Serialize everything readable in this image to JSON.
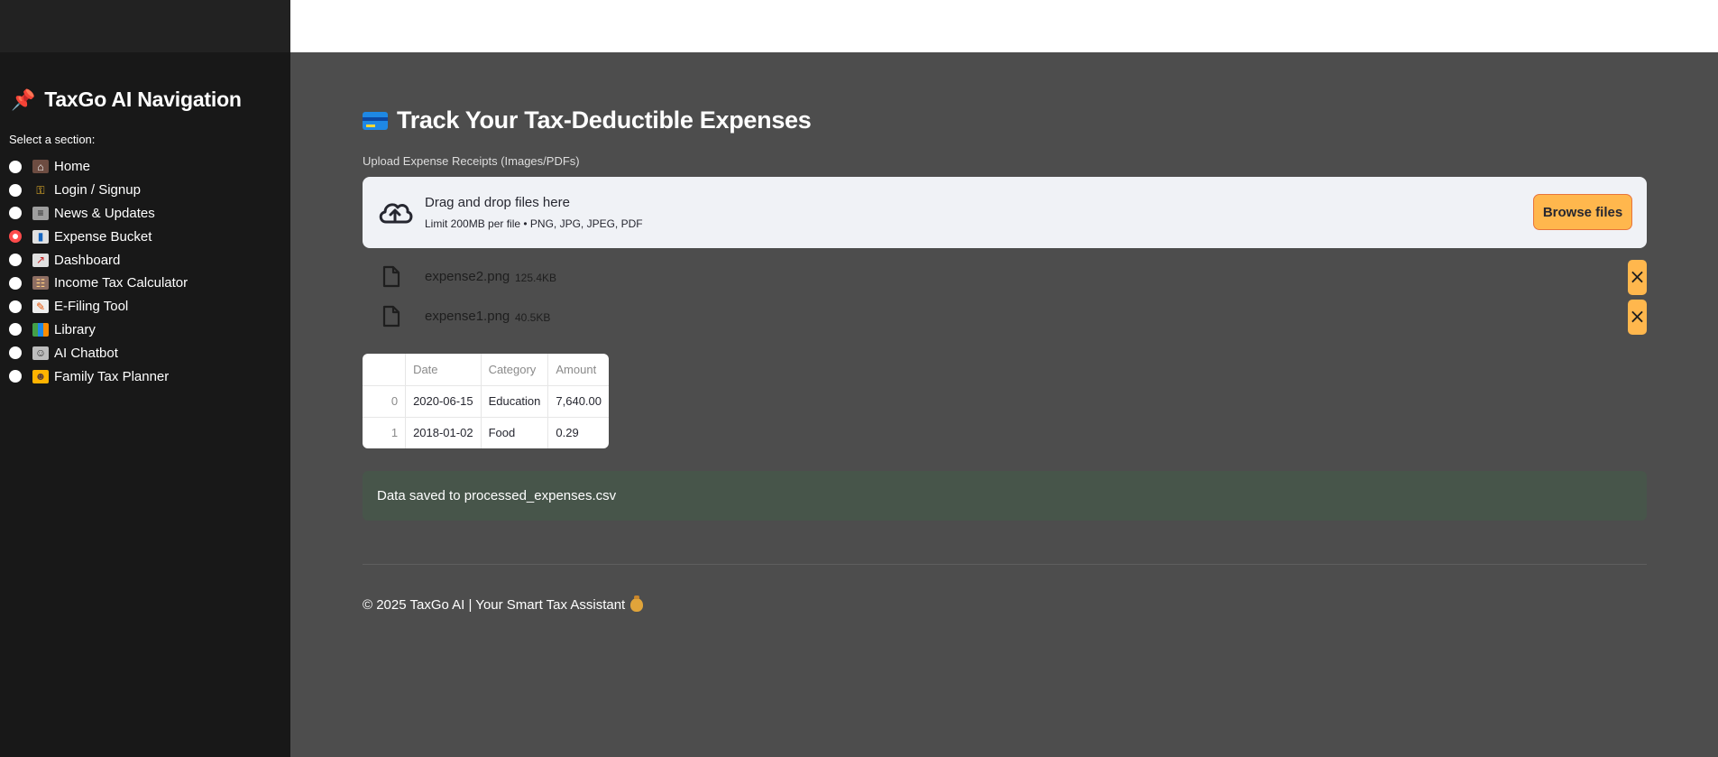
{
  "sidebar": {
    "title": "TaxGo AI Navigation",
    "section_label": "Select a section:",
    "items": [
      {
        "label": "Home",
        "icon": "house-icon",
        "selected": false
      },
      {
        "label": "Login / Signup",
        "icon": "key-icon",
        "selected": false
      },
      {
        "label": "News & Updates",
        "icon": "newspaper-icon",
        "selected": false
      },
      {
        "label": "Expense Bucket",
        "icon": "bar-chart-icon",
        "selected": true
      },
      {
        "label": "Dashboard",
        "icon": "chart-up-icon",
        "selected": false
      },
      {
        "label": "Income Tax Calculator",
        "icon": "abacus-icon",
        "selected": false
      },
      {
        "label": "E-Filing Tool",
        "icon": "memo-icon",
        "selected": false
      },
      {
        "label": "Library",
        "icon": "books-icon",
        "selected": false
      },
      {
        "label": "AI Chatbot",
        "icon": "robot-icon",
        "selected": false
      },
      {
        "label": "Family Tax Planner",
        "icon": "family-icon",
        "selected": false
      }
    ],
    "accent_color": "#ff4b4b"
  },
  "main": {
    "title": "Track Your Tax-Deductible Expenses",
    "upload": {
      "label": "Upload Expense Receipts (Images/PDFs)",
      "drop_text": "Drag and drop files here",
      "limit_text": "Limit 200MB per file • PNG, JPG, JPEG, PDF",
      "browse_label": "Browse files"
    },
    "files": [
      {
        "name": "expense2.png",
        "size": "125.4KB"
      },
      {
        "name": "expense1.png",
        "size": "40.5KB"
      }
    ],
    "table": {
      "columns": [
        "",
        "Date",
        "Category",
        "Amount"
      ],
      "rows": [
        [
          "0",
          "2020-06-15",
          "Education",
          "7,640.00"
        ],
        [
          "1",
          "2018-01-02",
          "Food",
          "0.29"
        ]
      ]
    },
    "success_message": "Data saved to processed_expenses.csv",
    "footer": "© 2025 TaxGo AI | Your Smart Tax Assistant"
  },
  "colors": {
    "button": "#ffb74d",
    "success_bg": "#47554a",
    "main_bg": "#4d4d4d",
    "sidebar_bg": "#181818"
  }
}
